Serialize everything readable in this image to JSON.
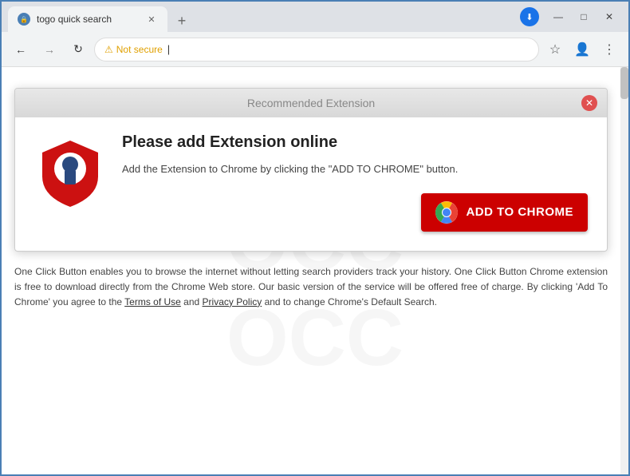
{
  "browser": {
    "tab": {
      "title": "togo quick search",
      "favicon": "🔒"
    },
    "controls": {
      "minimize": "—",
      "maximize": "□",
      "close": "✕",
      "new_tab": "+"
    },
    "nav": {
      "back": "←",
      "forward": "→",
      "reload": "↻",
      "security_label": "Not secure",
      "address": "",
      "divider": "|"
    }
  },
  "popup": {
    "header_title": "Recommended Extension",
    "close_btn": "✕",
    "heading": "Please add Extension online",
    "description": "Add the Extension to Chrome by clicking the \"ADD TO CHROME\" button.",
    "add_button_label": "ADD TO CHROME"
  },
  "disclaimer": {
    "text": "One Click Button enables you to browse the internet without letting search providers track your history. One Click Button Chrome extension is free to download directly from the Chrome Web store. Our basic version of the service will be offered free of charge. By clicking 'Add To Chrome' you agree to the ",
    "terms_link": "Terms of Use",
    "and_text": " and ",
    "privacy_link": "Privacy Policy",
    "end_text": " and to change Chrome's Default Search."
  },
  "watermark_lines": [
    "OCC",
    "OCC",
    "OCC"
  ]
}
